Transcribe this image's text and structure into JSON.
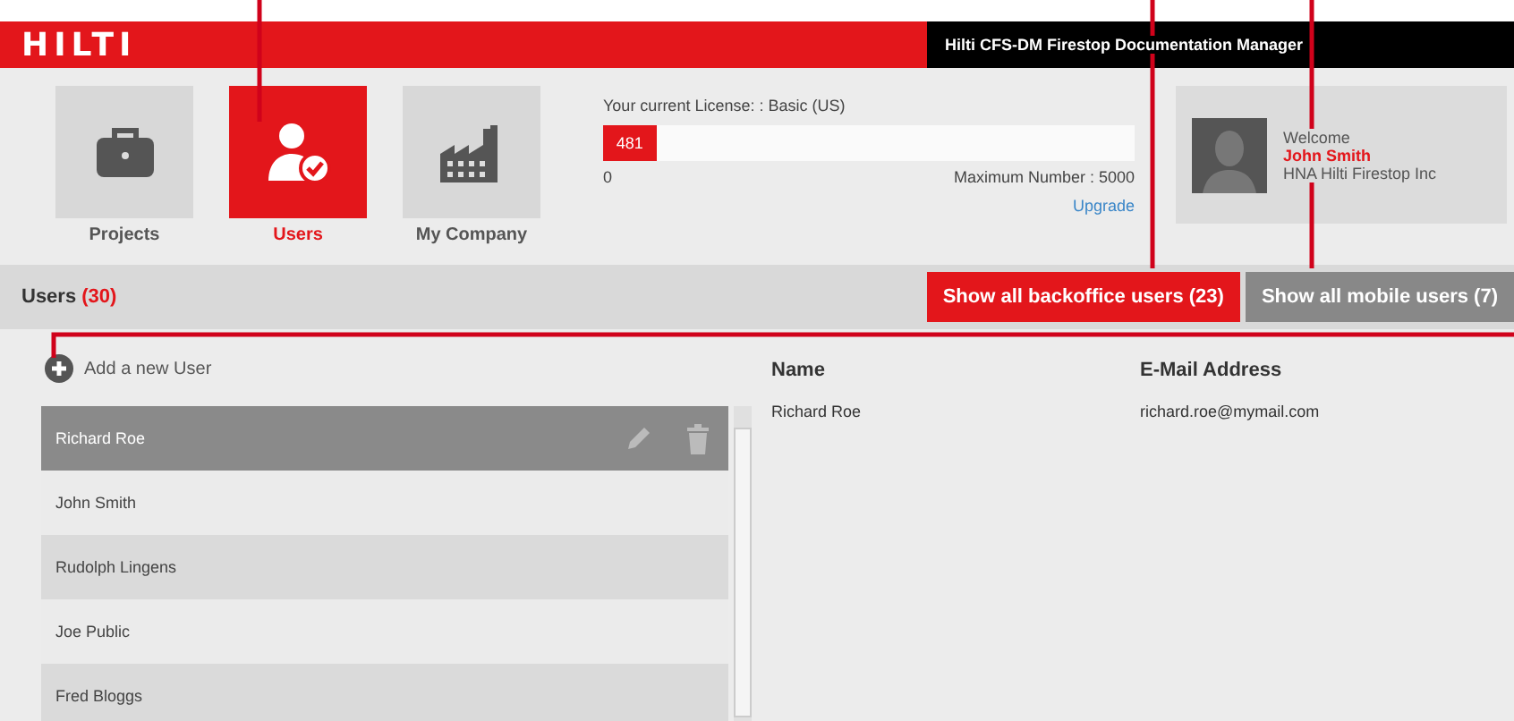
{
  "header": {
    "brand": "HILTI",
    "app_title": "Hilti CFS-DM Firestop Documentation Manager"
  },
  "nav": [
    {
      "label": "Projects",
      "kind": "briefcase",
      "selected": false
    },
    {
      "label": "Users",
      "kind": "users",
      "selected": true
    },
    {
      "label": "My Company",
      "kind": "factory",
      "selected": false
    }
  ],
  "license": {
    "label": "Your current License: : Basic (US)",
    "count": "481",
    "level": 0.1,
    "min": "0",
    "max": "Maximum Number : 5000",
    "upgrade": "Upgrade"
  },
  "welcome": {
    "greeting": "Welcome",
    "name": "John Smith",
    "company": "HNA Hilti Firestop Inc"
  },
  "users_bar": {
    "title": "Users",
    "count": "(30)",
    "filters": [
      {
        "label": "Show all backoffice users (23)",
        "selected": true
      },
      {
        "label": "Show all mobile users (7)",
        "selected": false
      }
    ]
  },
  "add_user": "Add a new User",
  "user_list": [
    {
      "name": "Richard Roe",
      "selected": true
    },
    {
      "name": "John Smith",
      "selected": false
    },
    {
      "name": "Rudolph Lingens",
      "selected": false
    },
    {
      "name": "Joe Public",
      "selected": false
    },
    {
      "name": "Fred Bloggs",
      "selected": false
    }
  ],
  "details": {
    "columns": [
      "Name",
      "E-Mail Address"
    ],
    "row": [
      "Richard Roe",
      "richard.roe@mymail.com"
    ]
  }
}
